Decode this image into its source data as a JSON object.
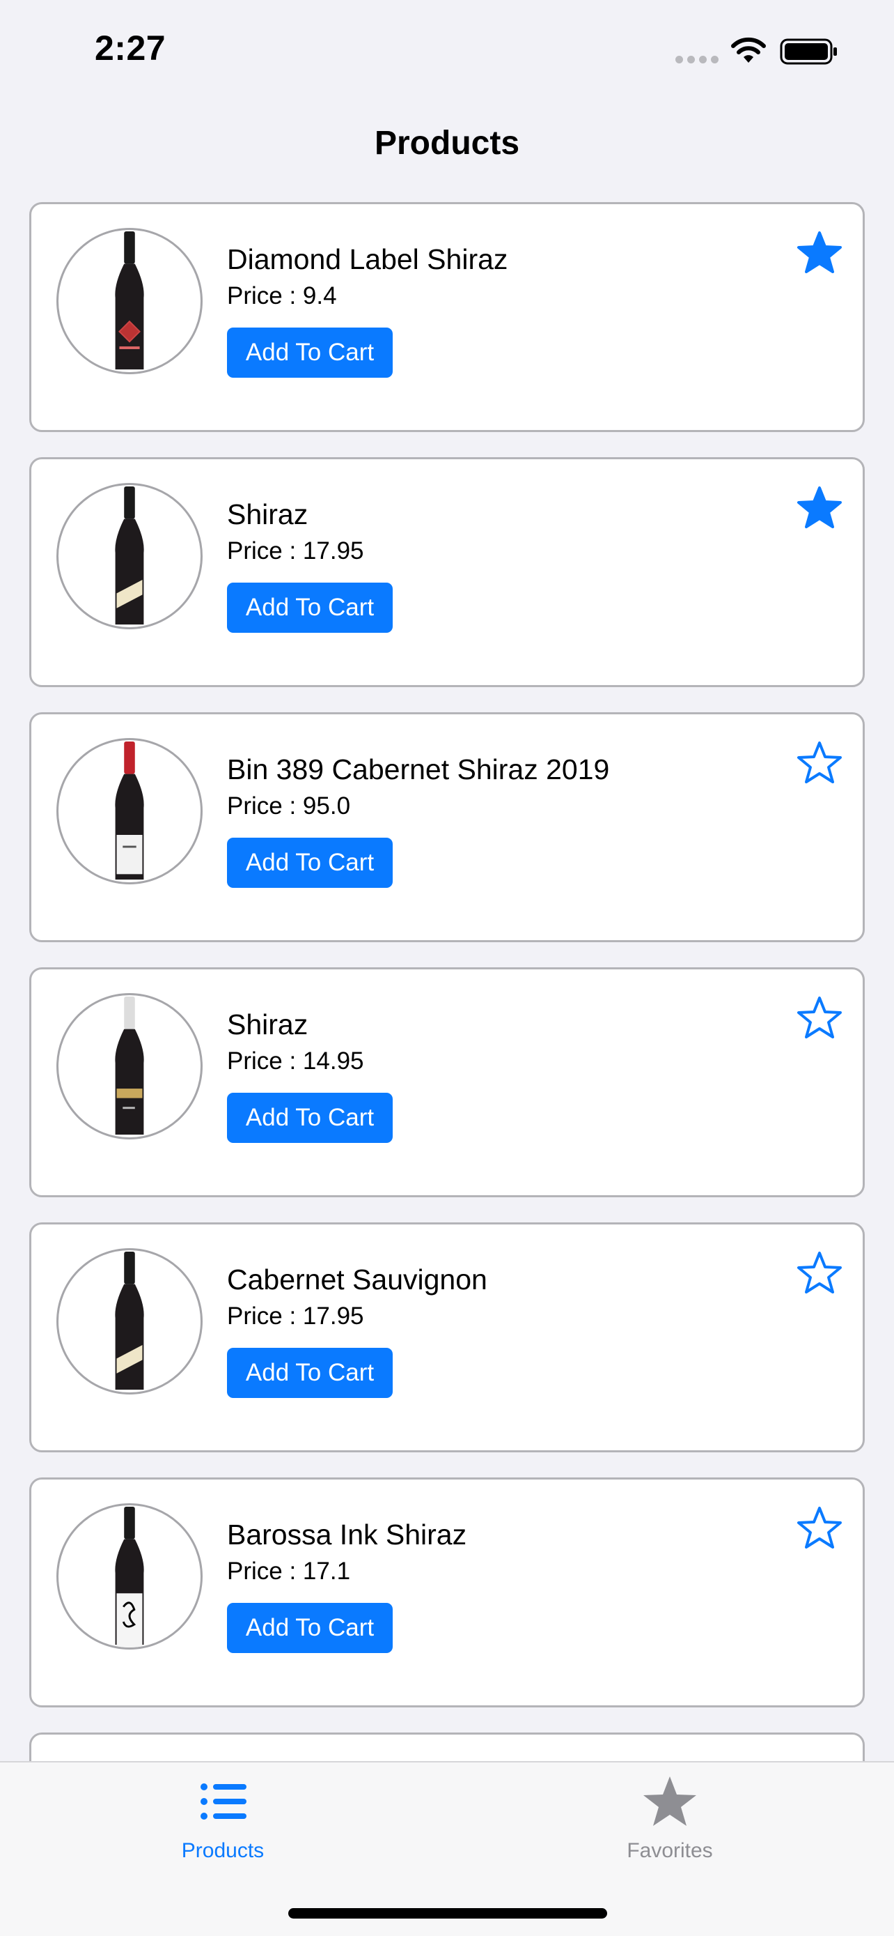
{
  "status_bar": {
    "time": "2:27"
  },
  "header": {
    "title": "Products"
  },
  "products": [
    {
      "name": "Diamond Label Shiraz",
      "price": "Price : 9.4",
      "button": "Add To Cart",
      "favorite": true,
      "bottle": "diamond"
    },
    {
      "name": "Shiraz",
      "price": "Price : 17.95",
      "button": "Add To Cart",
      "favorite": true,
      "bottle": "cream-label"
    },
    {
      "name": "Bin 389 Cabernet Shiraz 2019",
      "price": "Price : 95.0",
      "button": "Add To Cart",
      "favorite": false,
      "bottle": "white-label"
    },
    {
      "name": "Shiraz",
      "price": "Price : 14.95",
      "button": "Add To Cart",
      "favorite": false,
      "bottle": "black-label"
    },
    {
      "name": "Cabernet Sauvignon",
      "price": "Price : 17.95",
      "button": "Add To Cart",
      "favorite": false,
      "bottle": "cream-label"
    },
    {
      "name": "Barossa Ink Shiraz",
      "price": "Price : 17.1",
      "button": "Add To Cart",
      "favorite": false,
      "bottle": "ink-label"
    }
  ],
  "tab_bar": {
    "tabs": [
      {
        "label": "Products",
        "icon": "list-icon",
        "active": true
      },
      {
        "label": "Favorites",
        "icon": "star-icon",
        "active": false
      }
    ]
  },
  "colors": {
    "accent": "#0a7aff",
    "inactive": "#8e8e93",
    "background": "#f2f2f7"
  }
}
